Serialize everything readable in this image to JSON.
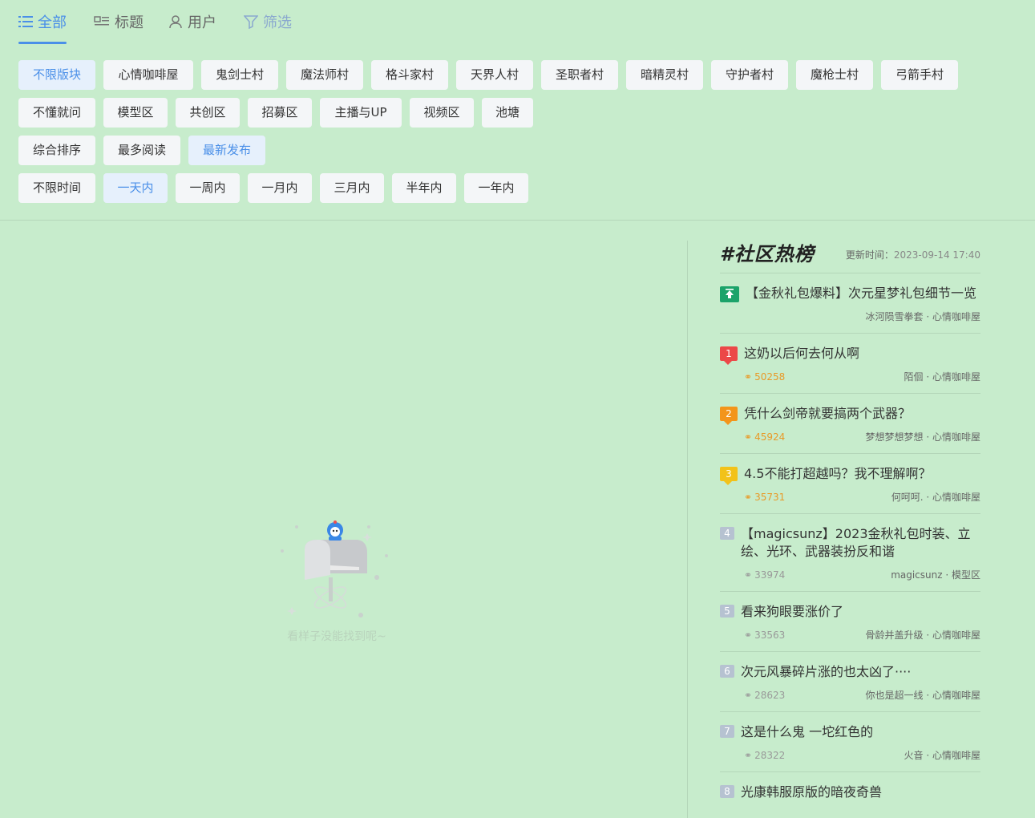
{
  "tabs": [
    {
      "label": "全部",
      "icon": "list-icon",
      "active": true
    },
    {
      "label": "标题",
      "icon": "title-icon",
      "active": false
    },
    {
      "label": "用户",
      "icon": "user-icon",
      "active": false
    },
    {
      "label": "筛选",
      "icon": "filter-icon",
      "active": false
    }
  ],
  "filters": {
    "boards": [
      "不限版块",
      "心情咖啡屋",
      "鬼剑士村",
      "魔法师村",
      "格斗家村",
      "天界人村",
      "圣职者村",
      "暗精灵村",
      "守护者村",
      "魔枪士村",
      "弓箭手村"
    ],
    "boards2": [
      "不懂就问",
      "模型区",
      "共创区",
      "招募区",
      "主播与UP",
      "视频区",
      "池塘"
    ],
    "sort": [
      "综合排序",
      "最多阅读",
      "最新发布"
    ],
    "time": [
      "不限时间",
      "一天内",
      "一周内",
      "一月内",
      "三月内",
      "半年内",
      "一年内"
    ],
    "selected": {
      "board": "不限版块",
      "sort": "最新发布",
      "time": "一天内"
    }
  },
  "empty_state": {
    "text": "看样子没能找到呢~"
  },
  "hot": {
    "title": "#社区热榜",
    "update_label": "更新时间：",
    "update_time": "2023-09-14 17:40",
    "top_item": {
      "title": "【金秋礼包爆料】次元星梦礼包细节一览",
      "author": "冰河陨雪拳套 · 心情咖啡屋"
    },
    "items": [
      {
        "rank": "1",
        "title": "这奶以后何去何从啊",
        "heat": "50258",
        "author": "陌佪 · 心情咖啡屋"
      },
      {
        "rank": "2",
        "title": "凭什么剑帝就要搞两个武器？",
        "heat": "45924",
        "author": "梦想梦想梦想 · 心情咖啡屋"
      },
      {
        "rank": "3",
        "title": "4.5不能打超越吗？我不理解啊？",
        "heat": "35731",
        "author": "何呵呵. · 心情咖啡屋"
      },
      {
        "rank": "4",
        "title": "【magicsunz】2023金秋礼包时装、立绘、光环、武器装扮反和谐",
        "heat": "33974",
        "author": "magicsunz · 模型区"
      },
      {
        "rank": "5",
        "title": "看来狗眼要涨价了",
        "heat": "33563",
        "author": "骨龄并盖升级 · 心情咖啡屋"
      },
      {
        "rank": "6",
        "title": "次元风暴碎片涨的也太凶了····",
        "heat": "28623",
        "author": "你也是超一线 · 心情咖啡屋"
      },
      {
        "rank": "7",
        "title": "这是什么鬼 一坨红色的",
        "heat": "28322",
        "author": "火音 · 心情咖啡屋"
      },
      {
        "rank": "8",
        "title": "光康韩服原版的暗夜奇兽",
        "heat": "",
        "author": ""
      }
    ]
  }
}
